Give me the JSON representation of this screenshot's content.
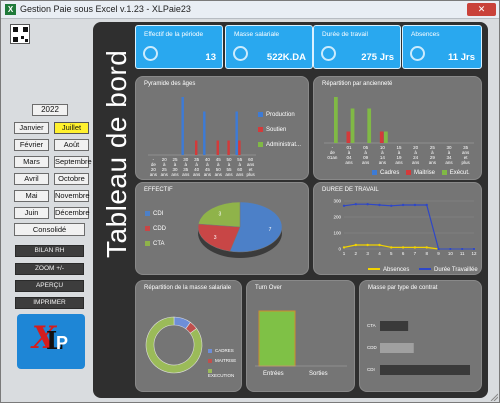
{
  "window": {
    "title": "Gestion Paie sous Excel v.1.23 - XLPaie23",
    "close_symbol": "✕"
  },
  "sidebar": {
    "year": "2022",
    "months": [
      "Janvier",
      "Juillet",
      "Février",
      "Août",
      "Mars",
      "Septembre",
      "Avril",
      "Octobre",
      "Mai",
      "Novembre",
      "Juin",
      "Décembre"
    ],
    "active_month": "Juillet",
    "consolide": "Consolidé",
    "buttons": [
      "BILAN RH",
      "ZOOM  +/-",
      "APERÇU",
      "IMPRIMER"
    ]
  },
  "dashboard": {
    "title": "Tableau de bord",
    "kpis": [
      {
        "title": "Effectif de la période",
        "value": "13",
        "icon": "people-icon"
      },
      {
        "title": "Masse salariale",
        "value": "522K.DA",
        "icon": "money-icon"
      },
      {
        "title": "Durée de travail",
        "value": "275 Jrs",
        "icon": "clock-icon"
      },
      {
        "title": "Absences",
        "value": "11 Jrs",
        "icon": "absence-icon"
      }
    ],
    "pyramide": {
      "title": "Pyramide des âges",
      "legend": [
        "Production",
        "Soutien",
        "Administrat..."
      ]
    },
    "anciennete": {
      "title": "Répartition par ancienneté",
      "legend": [
        "Cadres",
        "Maitrise",
        "Exécut."
      ]
    },
    "effectif": {
      "title": "EFFECTIF",
      "legend": [
        "CDI",
        "CDD",
        "CTA"
      ]
    },
    "duree_travail": {
      "title": "DUREE DE TRAVAIL",
      "legend": [
        "Absences",
        "Durée Travaillée"
      ]
    },
    "masse": {
      "title": "Répartition de la masse salariale",
      "legend": [
        "CADRES",
        "MAITRISE",
        "EXECUTION"
      ]
    },
    "turnover": {
      "title": "Turn Over",
      "x_labels": [
        "Entrées",
        "Sorties"
      ]
    },
    "contrat": {
      "title": "Masse par type de contrat",
      "y_labels": [
        "CTA",
        "CDD",
        "CDI"
      ]
    }
  },
  "chart_data": [
    {
      "type": "bar",
      "title": "Pyramide des âges",
      "categories": [
        "- de 20 ans",
        "20 à 25 ans",
        "25 à 30 ans",
        "30 à 35 ans",
        "35 à 40 ans",
        "40 à 45 ans",
        "45 à 50 ans",
        "50 à 55 ans",
        "55 à 60 ans",
        "60 ans et plus"
      ],
      "series": [
        {
          "name": "Production",
          "values": [
            0,
            0,
            0,
            4,
            0,
            3,
            0,
            0,
            3,
            0
          ]
        },
        {
          "name": "Soutien",
          "values": [
            0,
            0,
            0,
            0,
            1,
            0,
            1,
            1,
            1,
            0
          ]
        },
        {
          "name": "Administrat...",
          "values": [
            0,
            0,
            0,
            0,
            0,
            0,
            0,
            0,
            0,
            0
          ]
        }
      ],
      "colors": [
        "#3d7bd6",
        "#d43a3a",
        "#80b945"
      ]
    },
    {
      "type": "bar",
      "title": "Répartition par ancienneté",
      "categories": [
        "- de 01an",
        "01 à 04 ans",
        "05 à 09 ans",
        "10 à 14 ans",
        "15 à 19 ans",
        "20 à 24 ans",
        "25 à 29 ans",
        "30 à 34 ans",
        "35 ans et plus"
      ],
      "series": [
        {
          "name": "Cadres",
          "values": [
            0,
            0,
            0,
            0,
            0,
            0,
            0,
            0,
            0
          ]
        },
        {
          "name": "Maitrise",
          "values": [
            0,
            1,
            0,
            1,
            0,
            0,
            0,
            0,
            0
          ]
        },
        {
          "name": "Exécut.",
          "values": [
            4,
            3,
            3,
            1,
            0,
            0,
            0,
            0,
            0
          ]
        }
      ],
      "colors": [
        "#3d7bd6",
        "#d43a3a",
        "#80b945"
      ]
    },
    {
      "type": "pie",
      "title": "EFFECTIF",
      "categories": [
        "CDI",
        "CDD",
        "CTA"
      ],
      "values": [
        7,
        3,
        3
      ],
      "colors": [
        "#4c80c8",
        "#c84646",
        "#8fb34a"
      ]
    },
    {
      "type": "line",
      "title": "DUREE DE TRAVAIL",
      "x": [
        1,
        2,
        3,
        4,
        5,
        6,
        7,
        8,
        9,
        10,
        11,
        12
      ],
      "series": [
        {
          "name": "Absences",
          "values": [
            10,
            25,
            25,
            25,
            10,
            10,
            10,
            10,
            0,
            0,
            0,
            0
          ]
        },
        {
          "name": "Durée Travaillée",
          "values": [
            270,
            280,
            280,
            275,
            270,
            275,
            275,
            275,
            0,
            0,
            0,
            0
          ]
        }
      ],
      "ylim": [
        0,
        300
      ],
      "colors": [
        "#f2d300",
        "#2e47c7"
      ]
    },
    {
      "type": "pie",
      "title": "Répartition de la masse salariale",
      "categories": [
        "CADRES",
        "MAITRISE",
        "EXECUTION"
      ],
      "values": [
        10,
        5,
        85
      ],
      "colors": [
        "#6e8ed7",
        "#c0504d",
        "#9bbb59"
      ]
    },
    {
      "type": "bar",
      "title": "Turn Over",
      "categories": [
        "Entrées",
        "Sorties"
      ],
      "values": [
        1,
        0
      ],
      "colors": [
        "#7fc146",
        "#b5b5b5"
      ]
    },
    {
      "type": "bar",
      "title": "Masse par type de contrat",
      "categories": [
        "CTA",
        "CDD",
        "CDI"
      ],
      "values": [
        1,
        1.2,
        3.2
      ],
      "colors": [
        "#3a3a3a",
        "#a0a0a0",
        "#3a3a3a"
      ]
    }
  ]
}
